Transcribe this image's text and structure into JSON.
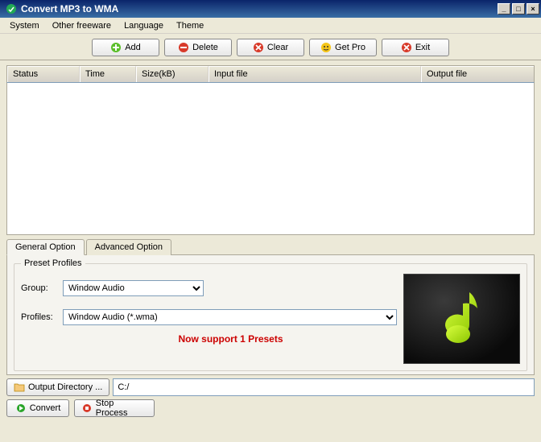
{
  "window": {
    "title": "Convert MP3 to WMA"
  },
  "menubar": [
    "System",
    "Other freeware",
    "Language",
    "Theme"
  ],
  "toolbar": {
    "add": "Add",
    "delete": "Delete",
    "clear": "Clear",
    "getpro": "Get Pro",
    "exit": "Exit"
  },
  "columns": {
    "status": "Status",
    "time": "Time",
    "size": "Size(kB)",
    "input": "Input file",
    "output": "Output file"
  },
  "tabs": {
    "general": "General Option",
    "advanced": "Advanced Option"
  },
  "preset": {
    "legend": "Preset Profiles",
    "group_label": "Group:",
    "group_value": "Window Audio",
    "profiles_label": "Profiles:",
    "profiles_value": "Window Audio (*.wma)",
    "support_text": "Now support 1 Presets"
  },
  "outdir": {
    "button": "Output Directory ...",
    "value": "C:/"
  },
  "bottom": {
    "convert": "Convert",
    "stop": "Stop Process"
  }
}
